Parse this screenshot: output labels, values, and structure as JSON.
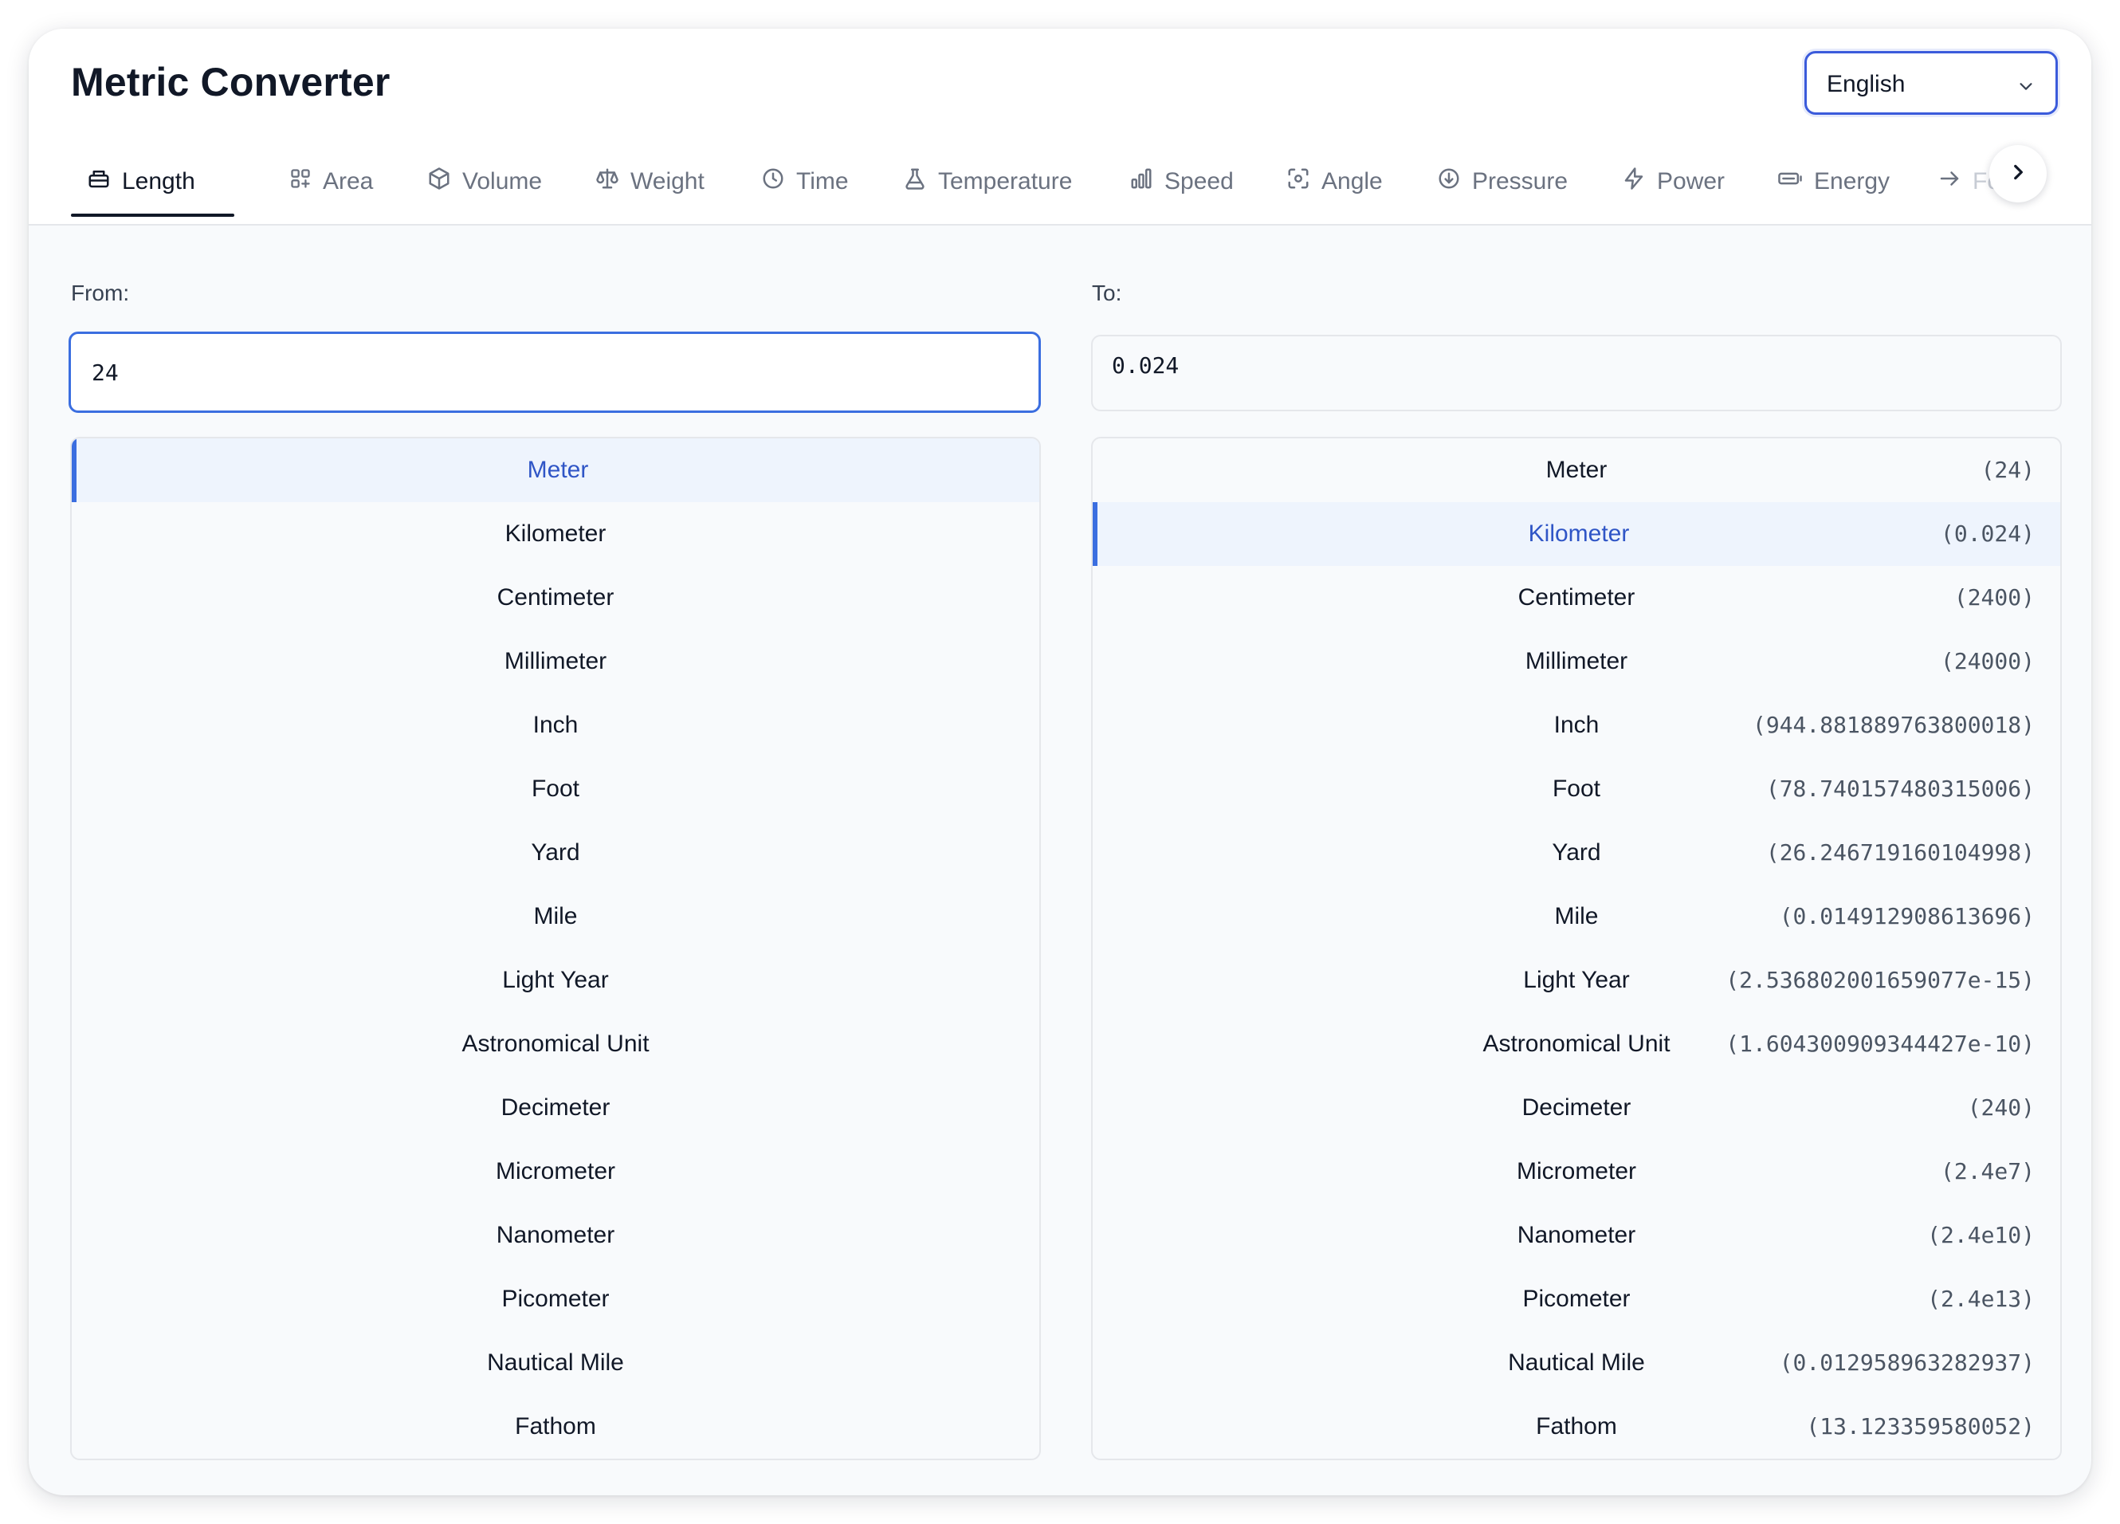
{
  "app": {
    "title": "Metric Converter"
  },
  "language": {
    "selected": "English"
  },
  "tabs": [
    {
      "label": "Length",
      "icon": "ruler-box-icon",
      "active": true
    },
    {
      "label": "Area",
      "icon": "grid-icon"
    },
    {
      "label": "Volume",
      "icon": "cube-icon"
    },
    {
      "label": "Weight",
      "icon": "scale-icon"
    },
    {
      "label": "Time",
      "icon": "clock-icon"
    },
    {
      "label": "Temperature",
      "icon": "flask-icon"
    },
    {
      "label": "Speed",
      "icon": "bar-chart-icon"
    },
    {
      "label": "Angle",
      "icon": "focus-icon"
    },
    {
      "label": "Pressure",
      "icon": "gauge-down-icon"
    },
    {
      "label": "Power",
      "icon": "bolt-icon"
    },
    {
      "label": "Energy",
      "icon": "battery-icon"
    },
    {
      "label": "Fo",
      "icon": "arrow-right-icon"
    }
  ],
  "from": {
    "label": "From:",
    "value": "24"
  },
  "to": {
    "label": "To:",
    "value": "0.024"
  },
  "from_units": [
    "Meter",
    "Kilometer",
    "Centimeter",
    "Millimeter",
    "Inch",
    "Foot",
    "Yard",
    "Mile",
    "Light Year",
    "Astronomical Unit",
    "Decimeter",
    "Micrometer",
    "Nanometer",
    "Picometer",
    "Nautical Mile",
    "Fathom"
  ],
  "from_selected": "Meter",
  "to_units": [
    {
      "name": "Meter",
      "value": "(24)"
    },
    {
      "name": "Kilometer",
      "value": "(0.024)"
    },
    {
      "name": "Centimeter",
      "value": "(2400)"
    },
    {
      "name": "Millimeter",
      "value": "(24000)"
    },
    {
      "name": "Inch",
      "value": "(944.881889763800018)"
    },
    {
      "name": "Foot",
      "value": "(78.740157480315006)"
    },
    {
      "name": "Yard",
      "value": "(26.246719160104998)"
    },
    {
      "name": "Mile",
      "value": "(0.014912908613696)"
    },
    {
      "name": "Light Year",
      "value": "(2.536802001659077e-15)"
    },
    {
      "name": "Astronomical Unit",
      "value": "(1.604300909344427e-10)"
    },
    {
      "name": "Decimeter",
      "value": "(240)"
    },
    {
      "name": "Micrometer",
      "value": "(2.4e7)"
    },
    {
      "name": "Nanometer",
      "value": "(2.4e10)"
    },
    {
      "name": "Picometer",
      "value": "(2.4e13)"
    },
    {
      "name": "Nautical Mile",
      "value": "(0.012958963282937)"
    },
    {
      "name": "Fathom",
      "value": "(13.123359580052)"
    }
  ],
  "to_selected": "Kilometer",
  "colors": {
    "accent": "#3b6ee0",
    "selected_text": "#2f55c6",
    "selected_bg": "#eef4fd"
  }
}
